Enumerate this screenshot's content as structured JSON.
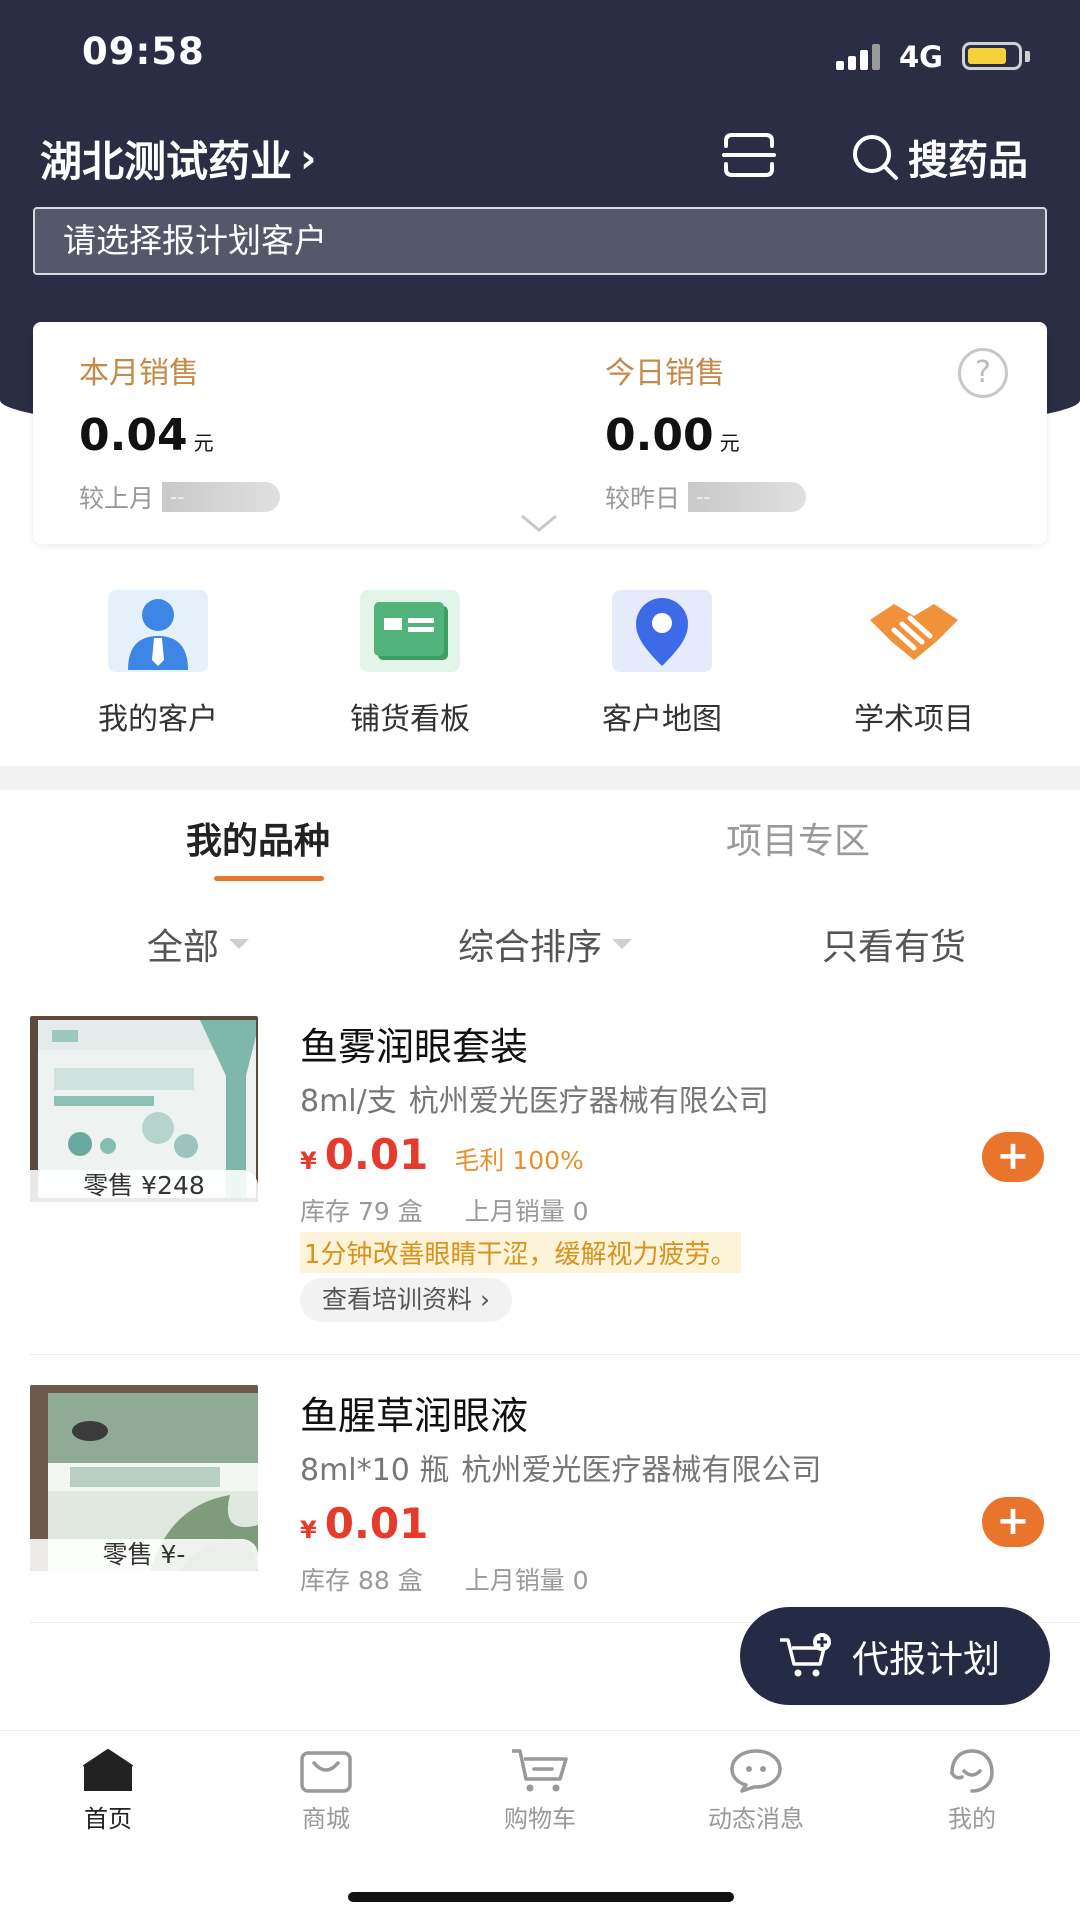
{
  "status_bar": {
    "time": "09:58",
    "network": "4G",
    "battery_level": 0.8
  },
  "header": {
    "company": "湖北测试药业",
    "company_chevron": "›",
    "scan_icon": "scan-icon",
    "search_label": "搜药品",
    "client_placeholder": "请选择报计划客户"
  },
  "sales": {
    "month": {
      "label": "本月销售",
      "value": "0.04",
      "unit": "元",
      "compare_label": "较上月",
      "compare_value": "--"
    },
    "today": {
      "label": "今日销售",
      "value": "0.00",
      "unit": "元",
      "compare_label": "较昨日",
      "compare_value": "--"
    },
    "help_symbol": "?"
  },
  "quick_entries": [
    {
      "label": "我的客户",
      "icon": "customer-icon"
    },
    {
      "label": "铺货看板",
      "icon": "board-icon"
    },
    {
      "label": "客户地图",
      "icon": "map-pin-icon"
    },
    {
      "label": "学术项目",
      "icon": "handshake-icon"
    }
  ],
  "tabs": {
    "active": "我的品种",
    "inactive": "项目专区"
  },
  "filters": {
    "all": "全部",
    "sort": "综合排序",
    "in_stock": "只看有货"
  },
  "products": [
    {
      "name": "鱼雾润眼套装",
      "spec": "8ml/支",
      "maker": "杭州爱光医疗器械有限公司",
      "currency": "¥",
      "price": "0.01",
      "margin": "毛利 100%",
      "stock": "库存  79 盒",
      "last_month_sales": "上月销量 0",
      "retail": "零售 ¥248",
      "tip": "1分钟改善眼睛干涩，缓解视力疲劳。",
      "training_label": "查看培训资料 ›",
      "add_symbol": "+"
    },
    {
      "name": "鱼腥草润眼液",
      "spec": "8ml*10 瓶",
      "maker": "杭州爱光医疗器械有限公司",
      "currency": "¥",
      "price": "0.01",
      "stock": "库存  88 盒",
      "last_month_sales": "上月销量 0",
      "retail": "零售 ¥-",
      "add_symbol": "+"
    }
  ],
  "float_button": {
    "label": "代报计划",
    "icon": "cart-plus-icon"
  },
  "bottom_nav": [
    {
      "label": "首页",
      "icon": "home-icon",
      "active": true
    },
    {
      "label": "商城",
      "icon": "shop-bag-icon",
      "active": false
    },
    {
      "label": "购物车",
      "icon": "cart-icon",
      "active": false
    },
    {
      "label": "动态消息",
      "icon": "message-icon",
      "active": false
    },
    {
      "label": "我的",
      "icon": "profile-icon",
      "active": false
    }
  ],
  "colors": {
    "header_bg": "#2b2d45",
    "accent": "#e9742c",
    "price": "#e53a2c",
    "sales_label": "#c38a4a"
  }
}
